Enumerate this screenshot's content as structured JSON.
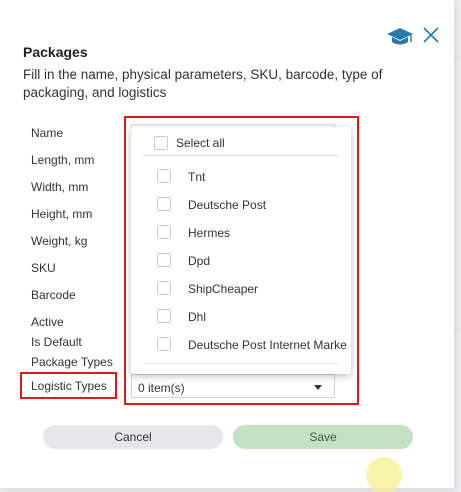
{
  "dialog": {
    "title": "Packages",
    "subtitle": "Fill in the name, physical parameters, SKU, barcode, type of packaging, and logistics"
  },
  "fields": [
    {
      "label": "Name"
    },
    {
      "label": "Length, mm"
    },
    {
      "label": "Width, mm"
    },
    {
      "label": "Height, mm"
    },
    {
      "label": "Weight, kg"
    },
    {
      "label": "SKU"
    },
    {
      "label": "Barcode"
    },
    {
      "label": "Active"
    },
    {
      "label": "Is Default"
    },
    {
      "label": "Package Types"
    },
    {
      "label": "Logistic Types"
    }
  ],
  "logistic_select": {
    "value": "0 item(s)"
  },
  "dropdown": {
    "select_all_label": "Select all",
    "options": [
      {
        "label": "Tnt",
        "checked": false
      },
      {
        "label": "Deutsche Post",
        "checked": false
      },
      {
        "label": "Hermes",
        "checked": false
      },
      {
        "label": "Dpd",
        "checked": false
      },
      {
        "label": "ShipCheaper",
        "checked": false
      },
      {
        "label": "Dhl",
        "checked": false
      },
      {
        "label": "Deutsche Post Internet Marke",
        "checked": false
      }
    ]
  },
  "buttons": {
    "cancel": "Cancel",
    "save": "Save"
  },
  "colors": {
    "highlight": "#e0191e",
    "save_bg": "#c3e2c2",
    "cancel_bg": "#e6e7e9",
    "icon": "#2a7ab0"
  },
  "icons": {
    "help": "graduation-cap-icon",
    "close": "close-icon"
  }
}
